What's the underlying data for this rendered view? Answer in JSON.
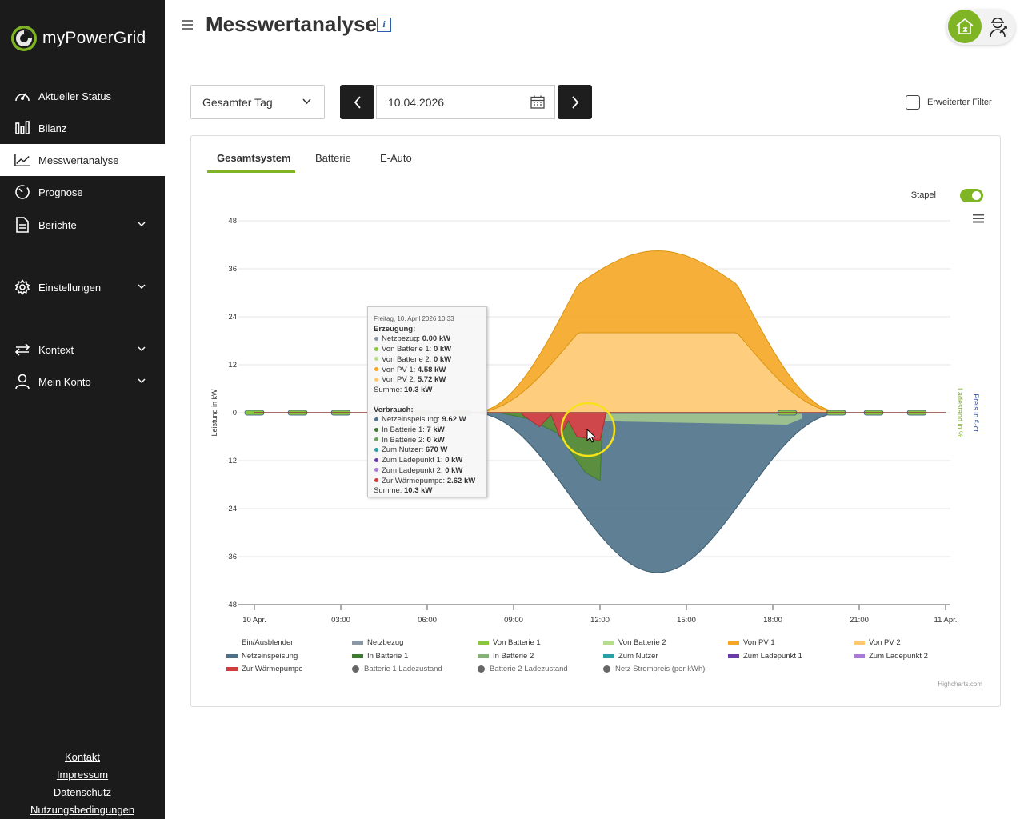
{
  "app": {
    "name": "myPowerGrid"
  },
  "sidebar": {
    "items": [
      {
        "label": "Aktueller Status",
        "icon": "gauge-icon"
      },
      {
        "label": "Bilanz",
        "icon": "bar-chart-icon"
      },
      {
        "label": "Messwertanalyse",
        "icon": "line-chart-icon",
        "active": true
      },
      {
        "label": "Prognose",
        "icon": "clock-icon"
      },
      {
        "label": "Berichte",
        "icon": "document-icon",
        "expandable": true
      },
      {
        "label": "Einstellungen",
        "icon": "gear-icon",
        "expandable": true
      },
      {
        "label": "Kontext",
        "icon": "swap-icon",
        "expandable": true
      },
      {
        "label": "Mein Konto",
        "icon": "user-icon",
        "expandable": true
      }
    ],
    "footer": [
      "Kontakt",
      "Impressum",
      "Datenschutz",
      "Nutzungsbedingungen"
    ]
  },
  "header": {
    "title": "Messwertanalyse",
    "info": "i"
  },
  "filters": {
    "range": "Gesamter Tag",
    "date": "10.04.2026",
    "extended_filter": "Erweiterter Filter"
  },
  "tabs": [
    "Gesamtsystem",
    "Batterie",
    "E-Auto"
  ],
  "stapel_label": "Stapel",
  "tooltip": {
    "datetime": "Freitag, 10. April 2026 10:33",
    "gen_header": "Erzeugung:",
    "gen": [
      {
        "label": "Netzbezug:",
        "value": "0.00 kW",
        "color": "#8a98a6"
      },
      {
        "label": "Von Batterie 1:",
        "value": "0 kW",
        "color": "#8cc63f"
      },
      {
        "label": "Von Batterie 2:",
        "value": "0 kW",
        "color": "#b7dc8b"
      },
      {
        "label": "Von PV 1:",
        "value": "4.58 kW",
        "color": "#f5a623"
      },
      {
        "label": "Von PV 2:",
        "value": "5.72 kW",
        "color": "#ffc870"
      }
    ],
    "gen_sum": {
      "label": "Summe:",
      "value": "10.3 kW"
    },
    "use_header": "Verbrauch:",
    "use": [
      {
        "label": "Netzeinspeisung:",
        "value": "9.62 W",
        "color": "#4d7188"
      },
      {
        "label": "In Batterie 1:",
        "value": "7 kW",
        "color": "#3d7a32"
      },
      {
        "label": "In Batterie 2:",
        "value": "0 kW",
        "color": "#6aa060"
      },
      {
        "label": "Zum Nutzer:",
        "value": "670 W",
        "color": "#2aa0a6"
      },
      {
        "label": "Zum Ladepunkt 1:",
        "value": "0 kW",
        "color": "#6a3ba8"
      },
      {
        "label": "Zum Ladepunkt 2:",
        "value": "0 kW",
        "color": "#a97ad6"
      },
      {
        "label": "Zur Wärmepumpe:",
        "value": "2.62 kW",
        "color": "#d13d3d"
      }
    ],
    "use_sum": {
      "label": "Summe:",
      "value": "10.3 kW"
    }
  },
  "legend": {
    "toggle_label": "Ein/Ausblenden",
    "items": [
      {
        "label": "Netzbezug",
        "color": "#8a98a6"
      },
      {
        "label": "Von Batterie 1",
        "color": "#8cc63f"
      },
      {
        "label": "Von Batterie 2",
        "color": "#b7dc8b"
      },
      {
        "label": "Von PV 1",
        "color": "#f5a623"
      },
      {
        "label": "Von PV 2",
        "color": "#ffc870"
      },
      {
        "label": "Netzeinspeisung",
        "color": "#4d7188"
      },
      {
        "label": "In Batterie 1",
        "color": "#3d7a32"
      },
      {
        "label": "In Batterie 2",
        "color": "#86b27a"
      },
      {
        "label": "Zum Nutzer",
        "color": "#2aa0a6"
      },
      {
        "label": "Zum Ladepunkt 1",
        "color": "#6a3ba8"
      },
      {
        "label": "Zum Ladepunkt 2",
        "color": "#a97ad6"
      },
      {
        "label": "Zur Wärmepumpe",
        "color": "#d13d3d"
      },
      {
        "label": "Batterie 1 Ladezustand",
        "hidden": true
      },
      {
        "label": "Batterie 2 Ladezustand",
        "hidden": true
      },
      {
        "label": "Netz Strompreis (per kWh)",
        "hidden": true
      }
    ]
  },
  "credits": "Highcharts.com",
  "chart_data": {
    "type": "area",
    "stacked": true,
    "ylabel": "Leistung in kW",
    "y2label": "Ladestand in %",
    "y3label": "Preis in €-ct",
    "ylim": [
      -48,
      48
    ],
    "yticks": [
      48,
      36,
      24,
      12,
      0,
      -12,
      -24,
      -36,
      -48
    ],
    "xticks": [
      "10 Apr.",
      "03:00",
      "06:00",
      "09:00",
      "12:00",
      "15:00",
      "18:00",
      "21:00",
      "11 Apr."
    ],
    "xlim": [
      0,
      24
    ],
    "pv1": {
      "name": "Von PV 1",
      "peak": 20.5,
      "center": 14.0,
      "start": 7.5,
      "end": 20.5
    },
    "pv2": {
      "name": "Von PV 2",
      "peak": 20,
      "center": 14.0,
      "start": 7.5,
      "end": 20.5
    },
    "netzeinspeisung": {
      "name": "Netzeinspeisung",
      "peak": -40,
      "center": 14.0
    },
    "in_batterie_1": [
      [
        8.5,
        0
      ],
      [
        9.5,
        -1.5
      ],
      [
        10.5,
        -5
      ],
      [
        11.0,
        -10
      ],
      [
        11.5,
        -15
      ],
      [
        12.0,
        -17
      ],
      [
        12.1,
        0
      ]
    ],
    "waermepumpe": [
      [
        9.3,
        -0.5
      ],
      [
        9.9,
        -3.5
      ],
      [
        10.3,
        -0.5
      ],
      [
        10.6,
        -6
      ],
      [
        10.9,
        -2
      ],
      [
        11.2,
        -6
      ],
      [
        12.0,
        -7
      ],
      [
        12.2,
        -0.5
      ]
    ],
    "in_batterie_2": [
      [
        11.0,
        -2
      ],
      [
        18.5,
        -3
      ],
      [
        19.0,
        -1.5
      ]
    ]
  }
}
